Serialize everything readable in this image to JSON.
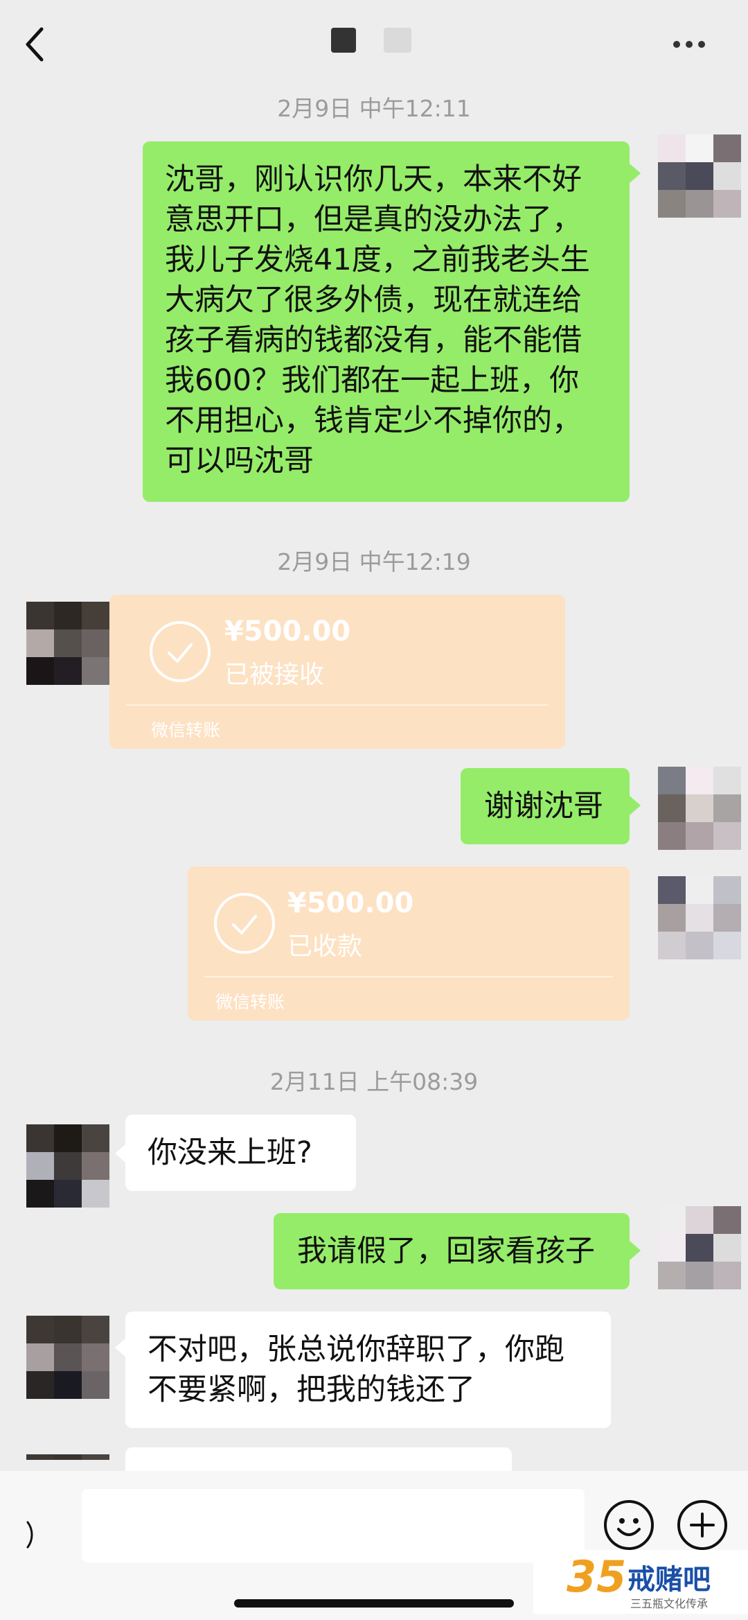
{
  "colors": {
    "sent_bubble": "#95ec69",
    "received_bubble": "#ffffff",
    "transfer_card": "#fde1c3",
    "background": "#ededed"
  },
  "header": {
    "back_icon": "chevron-left-icon",
    "more_icon": "more-dots-icon"
  },
  "messages": {
    "ts1": "2月9日 中午12:11",
    "m1_lines": [
      "沈哥，刚认识你几天，本来不好",
      "意思开口，但是真的没办法了，",
      "我儿子发烧41度，之前我老头生",
      "大病欠了很多外债，现在就连给",
      "孩子看病的钱都没有，能不能借",
      "我600？我们都在一起上班，你",
      "不用担心，钱肯定少不掉你的，",
      "可以吗沈哥"
    ],
    "ts2": "2月9日 中午12:19",
    "transfer1": {
      "amount": "¥500.00",
      "status": "已被接收",
      "footer": "微信转账"
    },
    "m2": "谢谢沈哥",
    "transfer2": {
      "amount": "¥500.00",
      "status": "已收款",
      "footer": "微信转账"
    },
    "ts3": "2月11日 上午08:39",
    "m3": "你没来上班?",
    "m4": "我请假了，回家看孩子",
    "m5_lines": [
      "不对吧，张总说你辞职了，你跑",
      "不要紧啊，把我的钱还了"
    ]
  },
  "input_bar": {
    "emoji_icon": "emoji-icon",
    "plus_icon": "plus-icon",
    "voice_icon": "voice-icon"
  },
  "watermark": {
    "number": "35",
    "brand": "戒赌吧",
    "tagline": "三五瓶文化传承"
  }
}
